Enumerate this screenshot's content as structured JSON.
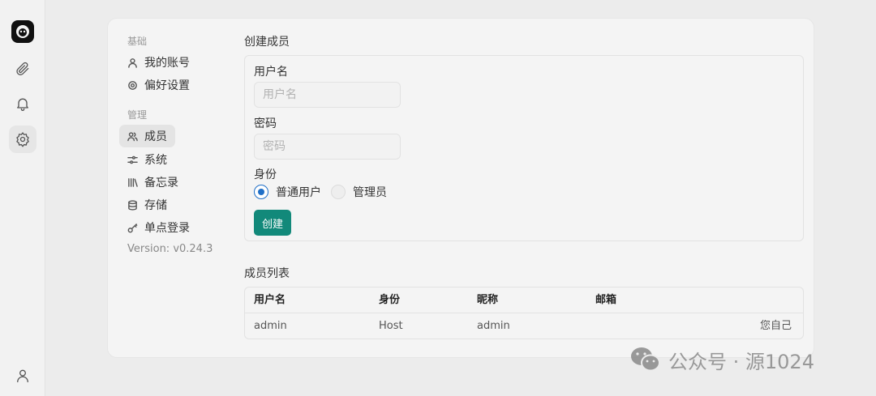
{
  "rail": {
    "items": [
      "logo-icon",
      "paperclip-icon",
      "bell-icon",
      "gear-icon",
      "user-icon"
    ],
    "active": "gear-icon"
  },
  "nav": {
    "section_basic": "基础",
    "my_account": "我的账号",
    "preferences": "偏好设置",
    "section_admin": "管理",
    "members": "成员",
    "system": "系统",
    "memo": "备忘录",
    "storage": "存储",
    "sso": "单点登录",
    "version": "Version: v0.24.3"
  },
  "create": {
    "title": "创建成员",
    "username_label": "用户名",
    "username_placeholder": "用户名",
    "username_value": "",
    "password_label": "密码",
    "password_placeholder": "密码",
    "password_value": "",
    "role_label": "身份",
    "role_options": [
      "普通用户",
      "管理员"
    ],
    "role_selected": "普通用户",
    "submit": "创建"
  },
  "members": {
    "title": "成员列表",
    "columns": [
      "用户名",
      "身份",
      "昵称",
      "邮箱"
    ],
    "rows": [
      {
        "username": "admin",
        "role": "Host",
        "nickname": "admin",
        "email": "",
        "action": "您自己"
      }
    ]
  },
  "colors": {
    "accent": "#12897a",
    "radio": "#1f6fc7"
  },
  "watermark": {
    "text": "公众号 · 源1024"
  }
}
